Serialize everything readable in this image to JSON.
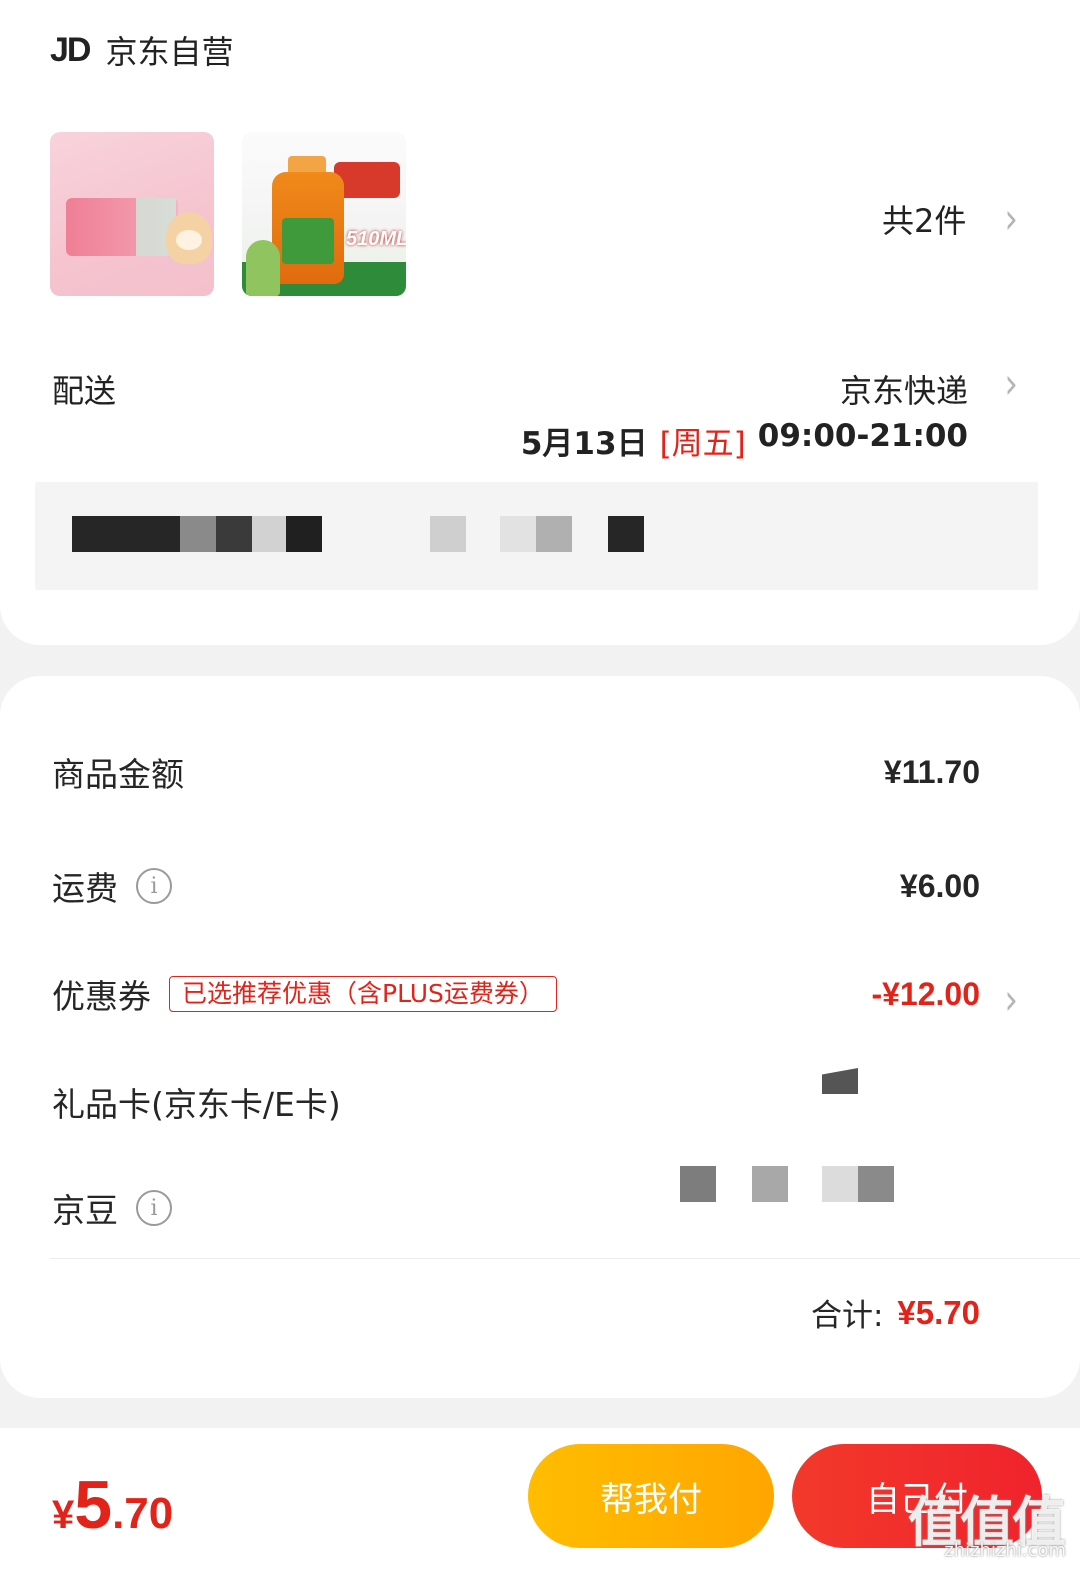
{
  "shop": {
    "logo": "JD",
    "name": "京东自营"
  },
  "order": {
    "item_count": "共2件",
    "thumb2_volume": "510ML"
  },
  "shipping": {
    "label": "配送",
    "method": "京东快递",
    "date": "5月13日",
    "weekday": "[周五]",
    "time": "09:00-21:00"
  },
  "summary": {
    "goods_label": "商品金额",
    "goods_value": "¥11.70",
    "freight_label": "运费",
    "freight_value": "¥6.00",
    "coupon_label": "优惠券",
    "coupon_tag": "已选推荐优惠（含PLUS运费券）",
    "coupon_value": "-¥12.00",
    "giftcard_label": "礼品卡(京东卡/E卡)",
    "jingdou_label": "京豆",
    "total_label": "合计:",
    "total_value": "¥5.70"
  },
  "bottom": {
    "price_currency": "¥",
    "price_int": "5",
    "price_dec": ".70",
    "help_pay": "帮我付",
    "self_pay": "自己付"
  },
  "watermark": {
    "text": "值值值",
    "url": "zhizhizhi.com"
  },
  "colors": {
    "accent_red": "#e2231a",
    "help_btn": "#ffb000",
    "self_btn": "#f0232c"
  },
  "icons": {
    "info": "info-icon",
    "chevron": "chevron-right-icon"
  }
}
